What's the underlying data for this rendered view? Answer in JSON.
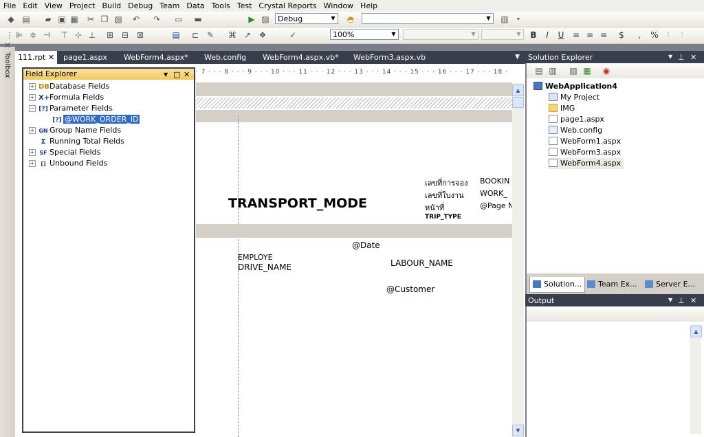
{
  "menu": [
    "File",
    "Edit",
    "View",
    "Project",
    "Build",
    "Debug",
    "Team",
    "Data",
    "Tools",
    "Test",
    "Crystal Reports",
    "Window",
    "Help"
  ],
  "toolbar": {
    "config_value": "Debug",
    "zoom_value": "100%",
    "format_buttons": [
      "B",
      "I",
      "U",
      "$",
      ",",
      "%"
    ]
  },
  "toolbox_label": "Toolbox",
  "doc_tabs": [
    "111.rpt",
    "page1.aspx",
    "WebForm4.aspx*",
    "Web.config",
    "WebForm4.aspx.vb*",
    "WebForm3.aspx.vb"
  ],
  "field_explorer": {
    "title": "Field Explorer",
    "items": [
      {
        "icon": "DB",
        "label": "Database Fields"
      },
      {
        "icon": "X+",
        "label": "Formula Fields"
      },
      {
        "icon": "[?]",
        "label": "Parameter Fields"
      },
      {
        "icon": "[?]",
        "label": "@WORK_ORDER_ID"
      },
      {
        "icon": "GN",
        "label": "Group Name Fields"
      },
      {
        "icon": "Σ",
        "label": "Running Total Fields"
      },
      {
        "icon": "SF",
        "label": "Special Fields"
      },
      {
        "icon": "[]",
        "label": "Unbound Fields"
      }
    ]
  },
  "report": {
    "ruler": "· 7 · · · 8 · · · 9 · · · 10 · · · 11 · · · 12 · · · 13 · · · 14 · · · 15 · · · 16 · · · 17 · · · 18 ·",
    "title": "TRANSPORT_MODE",
    "labels_th": [
      "เลขที่การจอง",
      "เลขที่ใบงาน",
      "หน้าที่"
    ],
    "trip_type": "TRIP_TYPE",
    "right_fields": [
      "BOOKIN",
      "WORK_",
      "@Page N"
    ],
    "date_field": "@Date",
    "employee": "EMPLOYE",
    "drive_name": "DRIVE_NAME",
    "labour_name": "LABOUR_NAME",
    "customer": "@Customer"
  },
  "solution_explorer": {
    "title": "Solution Explorer",
    "project": "WebApplication4",
    "items": [
      "My Project",
      "IMG",
      "page1.aspx",
      "Web.config",
      "WebForm1.aspx",
      "WebForm3.aspx",
      "WebForm4.aspx"
    ]
  },
  "side_tabs": [
    "Solution...",
    "Team Ex...",
    "Server E..."
  ],
  "output": {
    "title": "Output"
  },
  "colors": {
    "accent": "#316ac5",
    "pane_title": "#383e4c",
    "panel_bg": "#d4d0c8",
    "highlight": "#f2c75d"
  }
}
